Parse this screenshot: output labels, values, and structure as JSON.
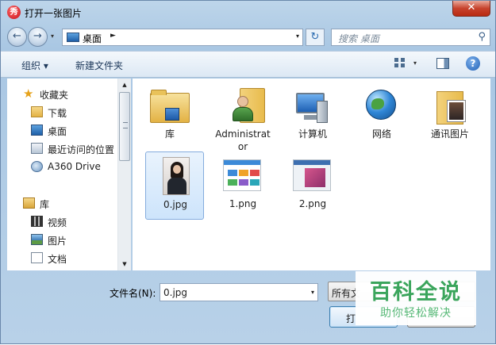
{
  "window": {
    "title": "打开一张图片",
    "app_icon_text": "秀",
    "close_glyph": "✕"
  },
  "nav": {
    "back_glyph": "←",
    "forward_glyph": "→",
    "dropdown_glyph": "▾",
    "address": {
      "crumb": "桌面",
      "crumb_arrow": "►",
      "dropdown_glyph": "▾"
    },
    "refresh_glyph": "↻",
    "search": {
      "placeholder": "搜索 桌面",
      "icon_glyph": "⚲"
    }
  },
  "toolbar": {
    "organize_label": "组织 ▾",
    "new_folder_label": "新建文件夹",
    "view_dropdown_glyph": "▾",
    "help_glyph": "?"
  },
  "sidebar": {
    "favorites_label": "收藏夹",
    "favorites": [
      {
        "label": "下载",
        "icon": "download-folder-icon"
      },
      {
        "label": "桌面",
        "icon": "desktop-icon"
      },
      {
        "label": "最近访问的位置",
        "icon": "recent-places-icon"
      },
      {
        "label": "A360 Drive",
        "icon": "cloud-drive-icon"
      }
    ],
    "library_label": "库",
    "libraries": [
      {
        "label": "视频",
        "icon": "video-library-icon"
      },
      {
        "label": "图片",
        "icon": "pictures-library-icon"
      },
      {
        "label": "文档",
        "icon": "documents-library-icon"
      }
    ],
    "scroll_up_glyph": "▲",
    "scroll_down_glyph": "▼"
  },
  "files": [
    {
      "name": "库",
      "icon": "libraries-folder-icon"
    },
    {
      "name": "Administrator",
      "icon": "user-folder-icon"
    },
    {
      "name": "计算机",
      "icon": "computer-icon"
    },
    {
      "name": "网络",
      "icon": "network-icon"
    },
    {
      "name": "通讯图片",
      "icon": "photo-folder-icon"
    },
    {
      "name": "0.jpg",
      "icon": "jpg-thumbnail",
      "selected": true
    },
    {
      "name": "1.png",
      "icon": "png-thumbnail"
    },
    {
      "name": "2.png",
      "icon": "png-thumbnail"
    }
  ],
  "bottom": {
    "filename_label": "文件名(N):",
    "filename_value": "0.jpg",
    "filename_dropdown_glyph": "▾",
    "filter_value": "所有文",
    "open_label": "打"
  },
  "watermark": {
    "main": "百科全说",
    "sub": "助你轻松解决"
  },
  "colors": {
    "accent": "#3c7fb1",
    "selection": "#cde4fb",
    "watermark_green": "#3ba55c"
  }
}
